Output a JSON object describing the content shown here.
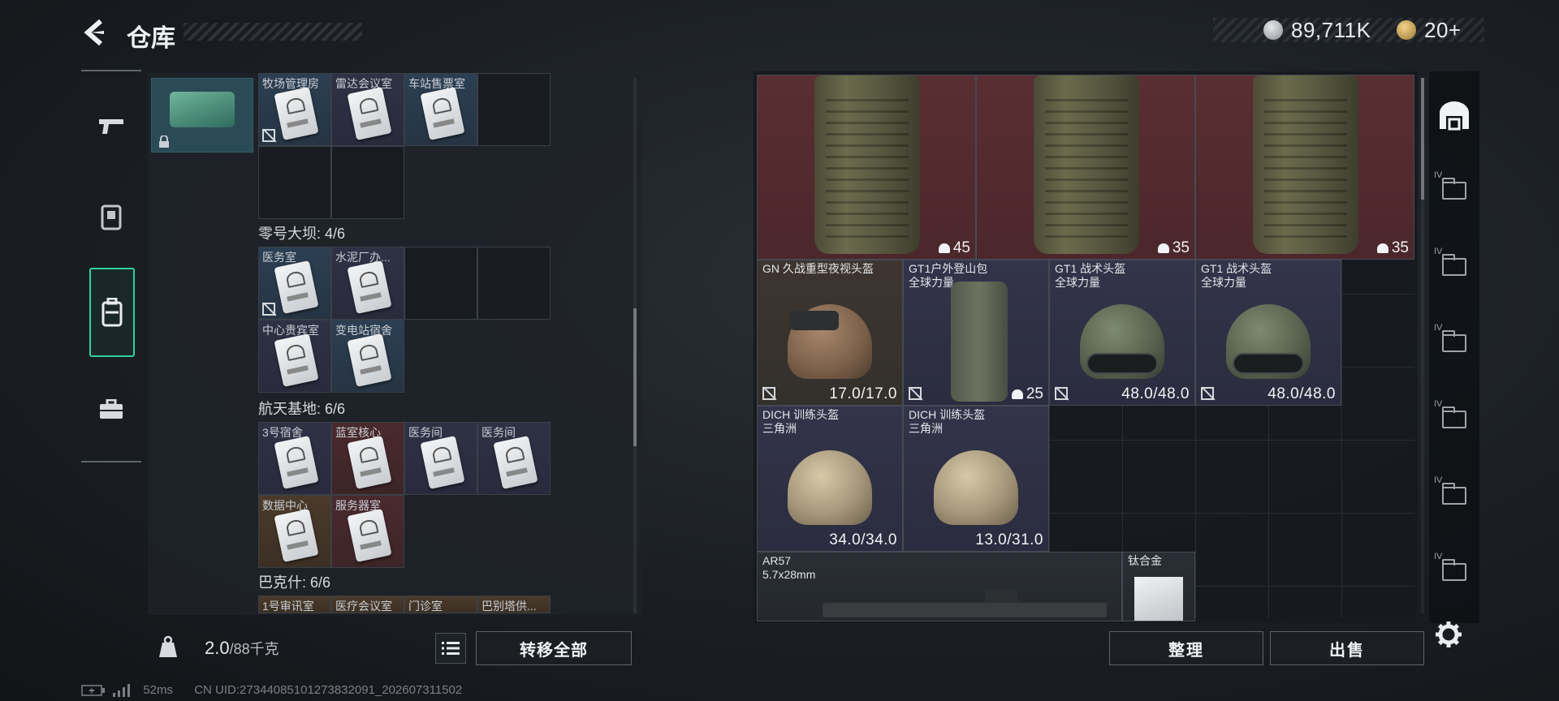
{
  "header": {
    "title": "仓库",
    "silver_amount": "89,711K",
    "gold_amount": "20+"
  },
  "left_nav": {
    "items": [
      "gun-icon",
      "armor-icon",
      "backpack-icon",
      "case-icon"
    ],
    "active": "backpack-icon"
  },
  "left_storage": {
    "top_row_labels": [
      "牧场管理房",
      "雷达会议室",
      "车站售票室"
    ],
    "sections": [
      {
        "title": "零号大坝: 4/6",
        "cards": [
          "医务室",
          "水泥厂办...",
          "中心贵宾室",
          "变电站宿舍"
        ]
      },
      {
        "title": "航天基地: 6/6",
        "cards": [
          "3号宿舍",
          "蓝室核心",
          "医务间",
          "医务间",
          "数据中心",
          "服务器室"
        ]
      },
      {
        "title": "巴克什: 6/6",
        "cards": [
          "1号审讯室",
          "医疗会议室",
          "门诊室",
          "巴别塔供..."
        ]
      }
    ]
  },
  "bottom_left": {
    "weight_value": "2.0",
    "weight_unit": "/88千克",
    "transfer_all": "转移全部"
  },
  "status_bar": {
    "ping": "52ms",
    "uid": "CN UID:27344085101273832091_202607311502"
  },
  "inventory": {
    "top_packs": [
      {
        "capacity": "45"
      },
      {
        "capacity": "35"
      },
      {
        "capacity": "35"
      }
    ],
    "items": [
      {
        "name1": "GN 久战重型夜视头盔",
        "name2": "",
        "value": "17.0/17.0"
      },
      {
        "name1": "GT1户外登山包",
        "name2": "全球力量",
        "value": "25"
      },
      {
        "name1": "GT1 战术头盔",
        "name2": "全球力量",
        "value": "48.0/48.0"
      },
      {
        "name1": "GT1 战术头盔",
        "name2": "全球力量",
        "value": "48.0/48.0"
      },
      {
        "name1": "DICH 训练头盔",
        "name2": "三角洲",
        "value": "34.0/34.0"
      },
      {
        "name1": "DICH 训练头盔",
        "name2": "三角洲",
        "value": "13.0/31.0"
      },
      {
        "name1": "AR57",
        "name2": "5.7x28mm",
        "value": ""
      },
      {
        "name1": "钛合金",
        "name2": "",
        "value": ""
      }
    ]
  },
  "actions": {
    "organize": "整理",
    "sell": "出售"
  },
  "side_nav": {
    "tab_label": "IV"
  }
}
